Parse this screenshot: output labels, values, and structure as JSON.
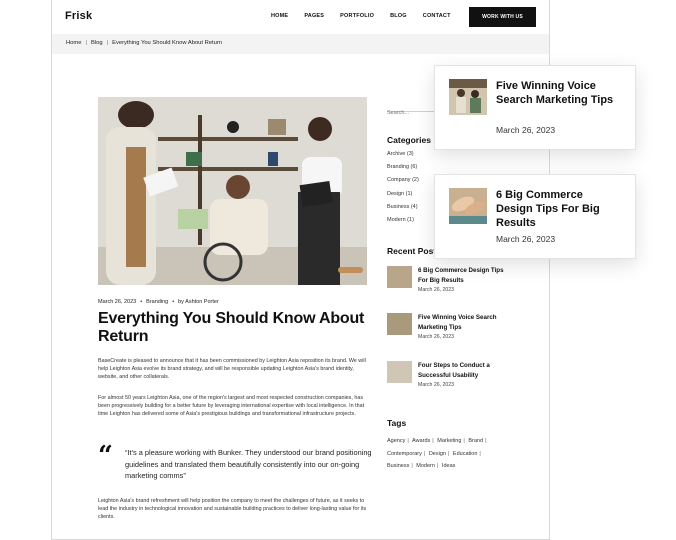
{
  "brand": {
    "logo": "Frisk"
  },
  "nav": {
    "items": [
      "HOME",
      "PAGES",
      "PORTFOLIO",
      "BLOG",
      "CONTACT"
    ],
    "cta": "WORK WITH US"
  },
  "breadcrumb": [
    "Home",
    "Blog",
    "Everything You Should Know About Return"
  ],
  "article": {
    "date": "March 26, 2023",
    "category": "Branding",
    "author": "by Ashton Porter",
    "title": "Everything You Should Know About Return",
    "p1": "BaseCreate is pleased to announce that it has been commissioned by Leighton Asia reposition its brand. We will help Leighton Asia evolve its brand strategy, and will be responsible updating Leighton Asia's brand identity, website, and other collaterals.",
    "p2": "For almost 50 years Leighton Asia, one of the region's largest and most respected construction companies, has been progressively building for a better future by leveraging international expertise with local intelligence. In that time Leighton has delivered some of Asia's prestigious buildings and transformational infrastructure projects.",
    "quote": "“It's a pleasure working with Bunker. They understood our brand positioning guidelines and translated them beautifully consistently into our on-going marketing comms”",
    "p3": "Leighton Asia's brand refreshment will help position the company to meet the challenges of future, as it seeks to lead the industry in technological innovation and sustainable building practices to deliver long-lasting value for its clients."
  },
  "sidebar": {
    "search_placeholder": "Search...",
    "categories_title": "Categories",
    "categories": [
      "Archive (3)",
      "Branding (6)",
      "Company (2)",
      "Design (1)",
      "Business (4)",
      "Modern (1)"
    ],
    "recent_title": "Recent Posts",
    "recent": [
      {
        "title": "6 Big Commerce Design Tips For Big Results",
        "date": "March 26, 2023"
      },
      {
        "title": "Five Winning Voice Search Marketing Tips",
        "date": "March 26, 2023"
      },
      {
        "title": "Four Steps to Conduct a Successful Usability",
        "date": "March 26, 2023"
      }
    ],
    "tags_title": "Tags",
    "tags": [
      "Agency",
      "Awards",
      "Marketing",
      "Brand",
      "Contemporary",
      "Design",
      "Education",
      "Business",
      "Modern",
      "Ideas"
    ]
  },
  "cards": [
    {
      "title": "Five Winning Voice Search Marketing Tips",
      "date": "March 26, 2023"
    },
    {
      "title": "6 Big Commerce Design Tips For Big Results",
      "date": "March 26, 2023"
    }
  ]
}
